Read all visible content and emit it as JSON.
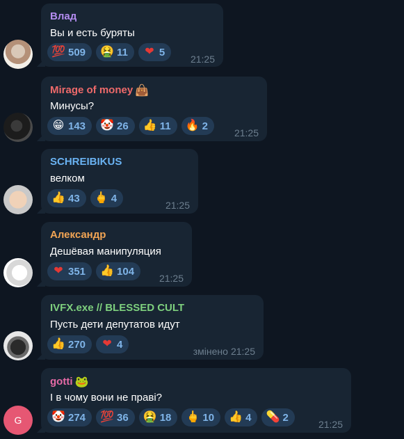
{
  "colors": {
    "background": "#0e1621",
    "bubble": "#182533",
    "reaction_bg": "#233b55",
    "reaction_count": "#7fb4e8",
    "time": "#6d7f8f"
  },
  "messages": [
    {
      "author": "Влад",
      "text": "Вы и есть буряты",
      "time": "21:25",
      "reactions": [
        {
          "icon": "hundred-points-icon",
          "glyph": "💯",
          "count": "509"
        },
        {
          "icon": "nauseated-face-icon",
          "glyph": "🤮",
          "count": "11"
        },
        {
          "icon": "heart-icon",
          "glyph": "❤",
          "count": "5"
        }
      ]
    },
    {
      "author": "Mirage of money",
      "author_badge_icon": "moneybag-sticker-icon",
      "author_badge_glyph": "👜",
      "text": "Минусы?",
      "time": "21:25",
      "reactions": [
        {
          "icon": "grinning-face-icon",
          "glyph": "😁",
          "count": "143"
        },
        {
          "icon": "clown-face-icon",
          "glyph": "🤡",
          "count": "26"
        },
        {
          "icon": "thumbs-up-icon",
          "glyph": "👍",
          "count": "11"
        },
        {
          "icon": "fire-icon",
          "glyph": "🔥",
          "count": "2"
        }
      ]
    },
    {
      "author": "SCHREIBIKUS",
      "text": "велком",
      "time": "21:25",
      "reactions": [
        {
          "icon": "thumbs-up-icon",
          "glyph": "👍",
          "count": "43"
        },
        {
          "icon": "middle-finger-icon",
          "glyph": "🖕",
          "count": "4"
        }
      ]
    },
    {
      "author": "Александр",
      "text": "Дешёвая манипуляция",
      "time": "21:25",
      "reactions": [
        {
          "icon": "heart-icon",
          "glyph": "❤",
          "count": "351"
        },
        {
          "icon": "thumbs-up-icon",
          "glyph": "👍",
          "count": "104"
        }
      ]
    },
    {
      "author": "IVFX.exe // BLESSED CULT",
      "text": "Пусть дети депутатов идут",
      "edited": "змінено",
      "time": "21:25",
      "reactions": [
        {
          "icon": "thumbs-up-icon",
          "glyph": "👍",
          "count": "270"
        },
        {
          "icon": "heart-icon",
          "glyph": "❤",
          "count": "4"
        }
      ]
    },
    {
      "author": "gotti",
      "author_badge_icon": "frog-sticker-icon",
      "author_badge_glyph": "🐸",
      "avatar_letter": "G",
      "text": "І в чому вони не праві?",
      "time": "21:25",
      "reactions": [
        {
          "icon": "clown-face-icon",
          "glyph": "🤡",
          "count": "274"
        },
        {
          "icon": "hundred-points-icon",
          "glyph": "💯",
          "count": "36"
        },
        {
          "icon": "nauseated-face-icon",
          "glyph": "🤮",
          "count": "18"
        },
        {
          "icon": "middle-finger-icon",
          "glyph": "🖕",
          "count": "10"
        },
        {
          "icon": "thumbs-up-icon",
          "glyph": "👍",
          "count": "4"
        },
        {
          "icon": "pill-icon",
          "glyph": "💊",
          "count": "2"
        }
      ]
    }
  ]
}
